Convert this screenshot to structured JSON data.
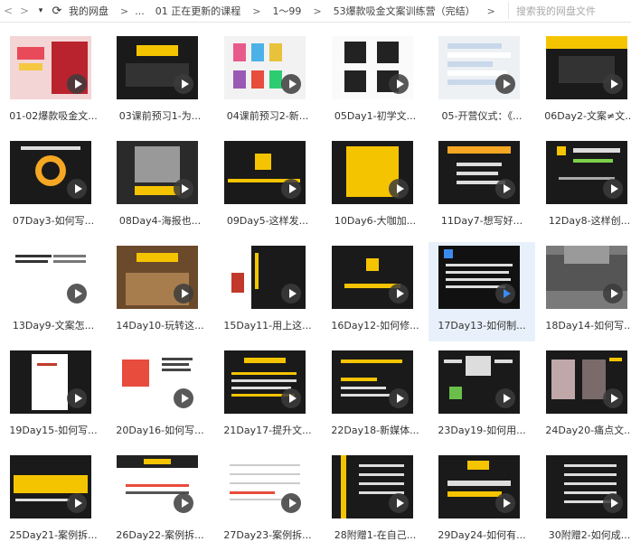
{
  "nav": {
    "back": "<",
    "forward": ">",
    "dropdown": "▾",
    "refresh": "⟳",
    "back_icon": "chevron-left-icon",
    "forward_icon": "chevron-right-icon",
    "refresh_icon": "refresh-icon"
  },
  "breadcrumbs": [
    "我的网盘",
    "...",
    "01 正在更新的课程",
    "1～99",
    "53爆款吸金文案训练营（完结）"
  ],
  "separator": ">",
  "search": {
    "placeholder": "搜索我的网盘文件"
  },
  "files": [
    {
      "label": "01-02爆款吸金文...",
      "theme": "photo"
    },
    {
      "label": "03课前预习1-为...",
      "theme": "dark-yellow"
    },
    {
      "label": "04课前预习2-新...",
      "theme": "products"
    },
    {
      "label": "05Day1-初学文...",
      "theme": "memes"
    },
    {
      "label": "05-开营仪式：《...",
      "theme": "chat"
    },
    {
      "label": "06Day2-文案≠文...",
      "theme": "yellow-circle"
    },
    {
      "label": "07Day3-如何写...",
      "theme": "ring"
    },
    {
      "label": "08Day4-海报也...",
      "theme": "poster"
    },
    {
      "label": "09Day5-这样发...",
      "theme": "yellow-icon"
    },
    {
      "label": "10Day6-大咖加...",
      "theme": "schedule"
    },
    {
      "label": "11Day7-想写好...",
      "theme": "orange-text"
    },
    {
      "label": "12Day8-这样创...",
      "theme": "green-text"
    },
    {
      "label": "13Day9-文案怎...",
      "theme": "white-doc"
    },
    {
      "label": "14Day10-玩转这...",
      "theme": "food"
    },
    {
      "label": "15Day11-用上这...",
      "theme": "split"
    },
    {
      "label": "16Day12-如何修...",
      "theme": "yellow-icon2"
    },
    {
      "label": "17Day13-如何制...",
      "theme": "dark-text",
      "selected": true
    },
    {
      "label": "18Day14-如何写...",
      "theme": "fabric"
    },
    {
      "label": "19Day15-如何写...",
      "theme": "phone"
    },
    {
      "label": "20Day16-如何写...",
      "theme": "two-page"
    },
    {
      "label": "21Day17-提升文...",
      "theme": "dark-list"
    },
    {
      "label": "22Day18-新媒体...",
      "theme": "dark-text2"
    },
    {
      "label": "23Day19-如何用...",
      "theme": "mindmap"
    },
    {
      "label": "24Day20-痛点文...",
      "theme": "photos"
    },
    {
      "label": "25Day21-案例拆...",
      "theme": "yellow-table"
    },
    {
      "label": "26Day22-案例拆...",
      "theme": "white-page"
    },
    {
      "label": "27Day23-案例拆...",
      "theme": "white-table"
    },
    {
      "label": "28附赠1-在自己...",
      "theme": "dark-lines"
    },
    {
      "label": "29Day24-如何有...",
      "theme": "part02"
    },
    {
      "label": "30附赠2-如何成...",
      "theme": "dark-lines2"
    }
  ]
}
